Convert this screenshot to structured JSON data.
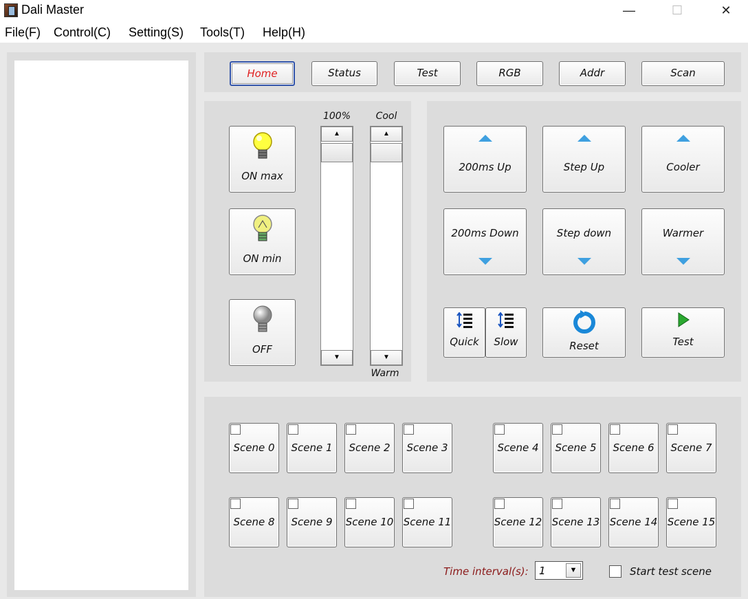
{
  "window": {
    "title": "Dali Master",
    "minimize_glyph": "—",
    "maximize_glyph": "☐",
    "close_glyph": "✕"
  },
  "menu": [
    {
      "label": "File(F)"
    },
    {
      "label": "Control(C)"
    },
    {
      "label": "Setting(S)"
    },
    {
      "label": "Tools(T)"
    },
    {
      "label": "Help(H)"
    }
  ],
  "tabs": [
    {
      "label": "Home",
      "active": true
    },
    {
      "label": "Status"
    },
    {
      "label": "Test"
    },
    {
      "label": "RGB"
    },
    {
      "label": "Addr"
    },
    {
      "label": "Scan"
    }
  ],
  "light": {
    "on_max": "ON max",
    "on_min": "ON min",
    "off": "OFF",
    "brightness_label": "100%",
    "cool_label": "Cool",
    "warm_label": "Warm",
    "brightness_level": 1.0,
    "colortemp_level": 1.0
  },
  "control": {
    "up200": "200ms Up",
    "step_up": "Step Up",
    "cooler": "Cooler",
    "down200": "200ms Down",
    "step_down": "Step down",
    "warmer": "Warmer",
    "quick": "Quick",
    "slow": "Slow",
    "reset": "Reset",
    "test": "Test"
  },
  "scenes": [
    "Scene 0",
    "Scene 1",
    "Scene 2",
    "Scene 3",
    "Scene 4",
    "Scene 5",
    "Scene 6",
    "Scene 7",
    "Scene 8",
    "Scene 9",
    "Scene 10",
    "Scene 11",
    "Scene 12",
    "Scene 13",
    "Scene 14",
    "Scene 15"
  ],
  "footer": {
    "interval_label": "Time interval(s):",
    "interval_value": "1",
    "start_test_label": "Start test scene",
    "start_test_checked": false
  },
  "colors": {
    "active_tab_text": "#e02020",
    "interval_label": "#8b1a1a",
    "arrow_blue": "#3fa0e0"
  }
}
